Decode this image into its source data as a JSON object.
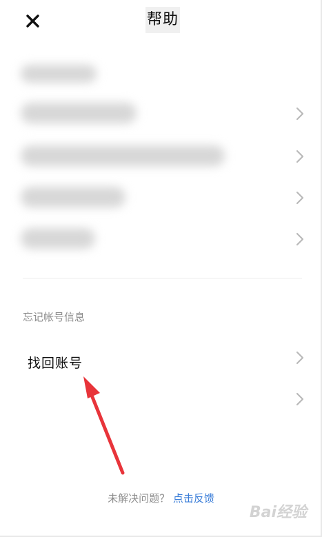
{
  "header": {
    "title": "帮助"
  },
  "icons": {
    "close": "close-icon",
    "chevron": "chevron-right-icon"
  },
  "blurred_section": {
    "rows_count_visible": 4
  },
  "forgot_section": {
    "label": "忘记帐号信息",
    "items": [
      {
        "label": "找回账号"
      },
      {
        "label": ""
      }
    ]
  },
  "footer": {
    "question": "未解决问题？",
    "link": "点击反馈"
  },
  "watermark": {
    "text": "Bai经验"
  },
  "colors": {
    "link": "#3a7dd8",
    "arrow": "#e8343a",
    "muted": "#8c8c8c"
  }
}
